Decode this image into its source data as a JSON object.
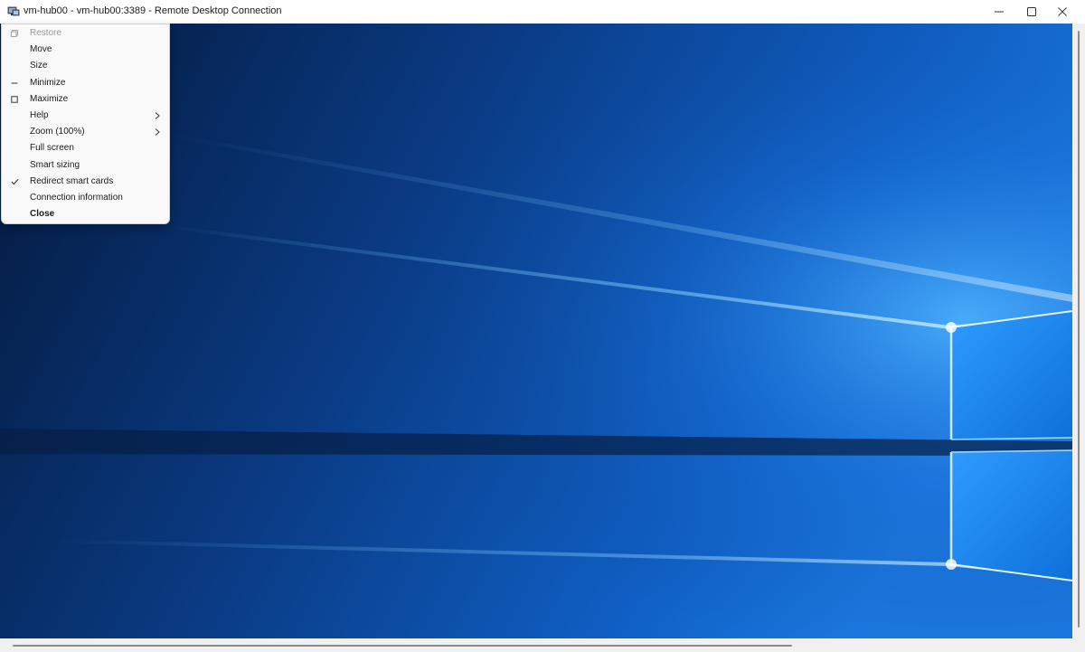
{
  "window": {
    "title": "vm-hub00 - vm-hub00:3389 - Remote Desktop Connection",
    "app_icon": "remote-desktop-icon"
  },
  "caption_buttons": {
    "minimize_icon": "minimize-icon",
    "maximize_icon": "maximize-icon",
    "close_icon": "close-icon"
  },
  "system_menu": {
    "items": [
      {
        "label": "Restore",
        "icon": "restore-icon",
        "disabled": true
      },
      {
        "label": "Move"
      },
      {
        "label": "Size"
      },
      {
        "label": "Minimize",
        "icon": "minimize-icon"
      },
      {
        "label": "Maximize",
        "icon": "maximize-icon"
      },
      {
        "label": "Help",
        "submenu": true
      },
      {
        "label": "Zoom (100%)",
        "submenu": true
      },
      {
        "label": "Full screen"
      },
      {
        "label": "Smart sizing"
      },
      {
        "label": "Redirect smart cards",
        "checked": true
      },
      {
        "label": "Connection information"
      },
      {
        "label": "Close",
        "bold": true
      }
    ]
  },
  "desktop": {
    "wallpaper": "windows-10-hero-wallpaper",
    "colors": {
      "dark": "#061a3d",
      "mid": "#0b4aa0",
      "light": "#3aa0ff",
      "glow": "#bfe6ff"
    }
  }
}
